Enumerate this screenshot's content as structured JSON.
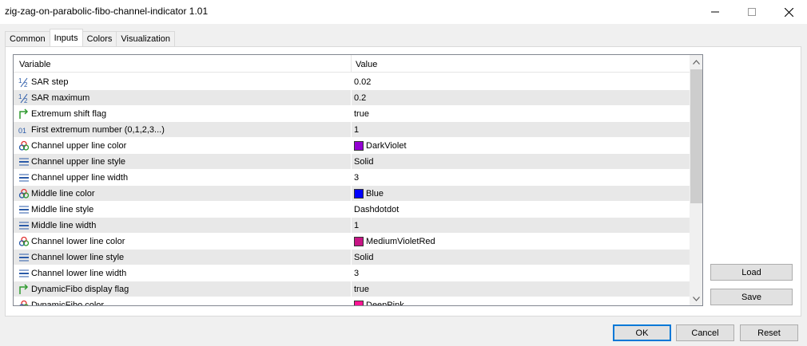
{
  "window": {
    "title": "zig-zag-on-parabolic-fibo-channel-indicator 1.01",
    "minimize_glyph": "—",
    "maximize_glyph": "☐",
    "close_glyph": "✕"
  },
  "tabs": [
    {
      "label": "Common",
      "active": false
    },
    {
      "label": "Inputs",
      "active": true
    },
    {
      "label": "Colors",
      "active": false
    },
    {
      "label": "Visualization",
      "active": false
    }
  ],
  "grid": {
    "header_variable": "Variable",
    "header_value": "Value",
    "rows": [
      {
        "icon": "fraction-icon",
        "variable": "SAR step",
        "value": "0.02"
      },
      {
        "icon": "fraction-icon",
        "variable": "SAR maximum",
        "value": "0.2"
      },
      {
        "icon": "bool-arrow-icon",
        "variable": "Extremum shift flag",
        "value": "true"
      },
      {
        "icon": "integer-icon",
        "variable": "First extremum number (0,1,2,3...)",
        "value": "1"
      },
      {
        "icon": "color-palette-icon",
        "variable": "Channel upper line color",
        "value": "DarkViolet",
        "swatch": "#9400d3"
      },
      {
        "icon": "line-style-icon",
        "variable": "Channel upper line style",
        "value": "Solid"
      },
      {
        "icon": "line-style-icon",
        "variable": "Channel upper line width",
        "value": "3"
      },
      {
        "icon": "color-palette-icon",
        "variable": "Middle line color",
        "value": "Blue",
        "swatch": "#0000ff"
      },
      {
        "icon": "line-style-icon",
        "variable": "Middle line style",
        "value": "Dashdotdot"
      },
      {
        "icon": "line-style-icon",
        "variable": "Middle line width",
        "value": "1"
      },
      {
        "icon": "color-palette-icon",
        "variable": "Channel lower line color",
        "value": "MediumVioletRed",
        "swatch": "#c71585"
      },
      {
        "icon": "line-style-icon",
        "variable": "Channel lower line style",
        "value": "Solid"
      },
      {
        "icon": "line-style-icon",
        "variable": "Channel lower line width",
        "value": "3"
      },
      {
        "icon": "bool-arrow-icon",
        "variable": "DynamicFibo display flag",
        "value": "true"
      },
      {
        "icon": "color-palette-icon",
        "variable": "DynamicFibo color",
        "value": "DeepPink",
        "swatch": "#ff1493"
      }
    ]
  },
  "buttons": {
    "load": "Load",
    "save": "Save",
    "ok": "OK",
    "cancel": "Cancel",
    "reset": "Reset"
  },
  "colors": {
    "ok_border": "#0078d7",
    "row_alt": "#e8e8e8",
    "fraction_icon": "#2a5aa8",
    "bool_icon": "#2e9a2e",
    "integer_icon": "#2a5aa8",
    "line_icon": "#2a5aa8"
  }
}
